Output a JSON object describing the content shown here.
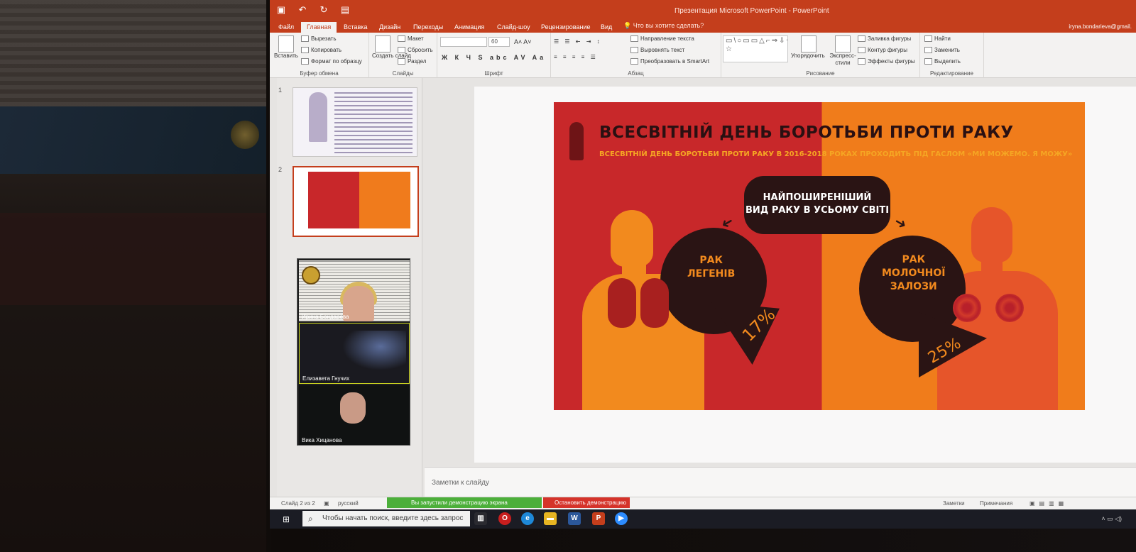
{
  "window": {
    "title": "Презентация Microsoft PowerPoint - PowerPoint",
    "user": "iryna.bondarieva@gmail."
  },
  "tabs": [
    "Файл",
    "Главная",
    "Вставка",
    "Дизайн",
    "Переходы",
    "Анимация",
    "Слайд-шоу",
    "Рецензирование",
    "Вид"
  ],
  "tell_me": "Что вы хотите сделать?",
  "ribbon": {
    "clipboard": {
      "label": "Буфер обмена",
      "paste": "Вставить",
      "cut": "Вырезать",
      "copy": "Копировать",
      "format_painter": "Формат по образцу"
    },
    "slides": {
      "label": "Слайды",
      "new_slide": "Создать слайд",
      "layout": "Макет",
      "reset": "Сбросить",
      "section": "Раздел"
    },
    "font": {
      "label": "Шрифт",
      "size": "60"
    },
    "paragraph": {
      "label": "Абзац",
      "text_direction": "Направление текста",
      "align_text": "Выровнять текст",
      "smartart": "Преобразовать в SmartArt"
    },
    "drawing": {
      "label": "Рисование",
      "arrange": "Упорядочить",
      "quick_styles": "Экспресс-стили",
      "shape_fill": "Заливка фигуры",
      "shape_outline": "Контур фигуры",
      "shape_effects": "Эффекты фигуры"
    },
    "editing": {
      "label": "Редактирование",
      "find": "Найти",
      "replace": "Заменить",
      "select": "Выделить"
    }
  },
  "thumbnails": [
    {
      "num": "1"
    },
    {
      "num": "2"
    }
  ],
  "video": {
    "p1": "Ирина Бондарева",
    "p2": "Елизавета Гнучих",
    "p3": "Вика Хицанова"
  },
  "slide": {
    "title": "ВСЕСВІТНІЙ ДЕНЬ БОРОТЬБИ ПРОТИ РАКУ",
    "subtitle": "ВСЕСВІТНІЙ ДЕНЬ БОРОТЬБИ ПРОТИ РАКУ В 2016-2018 РОКАХ ПРОХОДИТЬ ПІД ГАСЛОМ «МИ МОЖЕМО. Я МОЖУ»",
    "bubble_l1": "НАЙПОШИРЕНІШИЙ",
    "bubble_l2": "ВИД РАКУ В УСЬОМУ СВІТІ",
    "left_l1": "РАК",
    "left_l2": "ЛЕГЕНІВ",
    "left_pct": "17%",
    "right_l1": "РАК",
    "right_l2": "МОЛОЧНОЇ",
    "right_l3": "ЗАЛОЗИ",
    "right_pct": "25%",
    "left_share": 0.17,
    "right_share": 0.25
  },
  "notes_placeholder": "Заметки к слайду",
  "status": {
    "slide_count": "Слайд 2 из 2",
    "language": "русский",
    "share_on": "Вы запустили демонстрацию экрана",
    "share_stop": "Остановить демонстрацию",
    "notes": "Заметки",
    "comments": "Примечания"
  },
  "taskbar": {
    "search_placeholder": "Чтобы начать поиск, введите здесь запрос"
  },
  "colors": {
    "accent": "#c43e1c",
    "slide_red": "#c8282a",
    "slide_orange": "#f07c1b",
    "dark": "#2a1414"
  }
}
